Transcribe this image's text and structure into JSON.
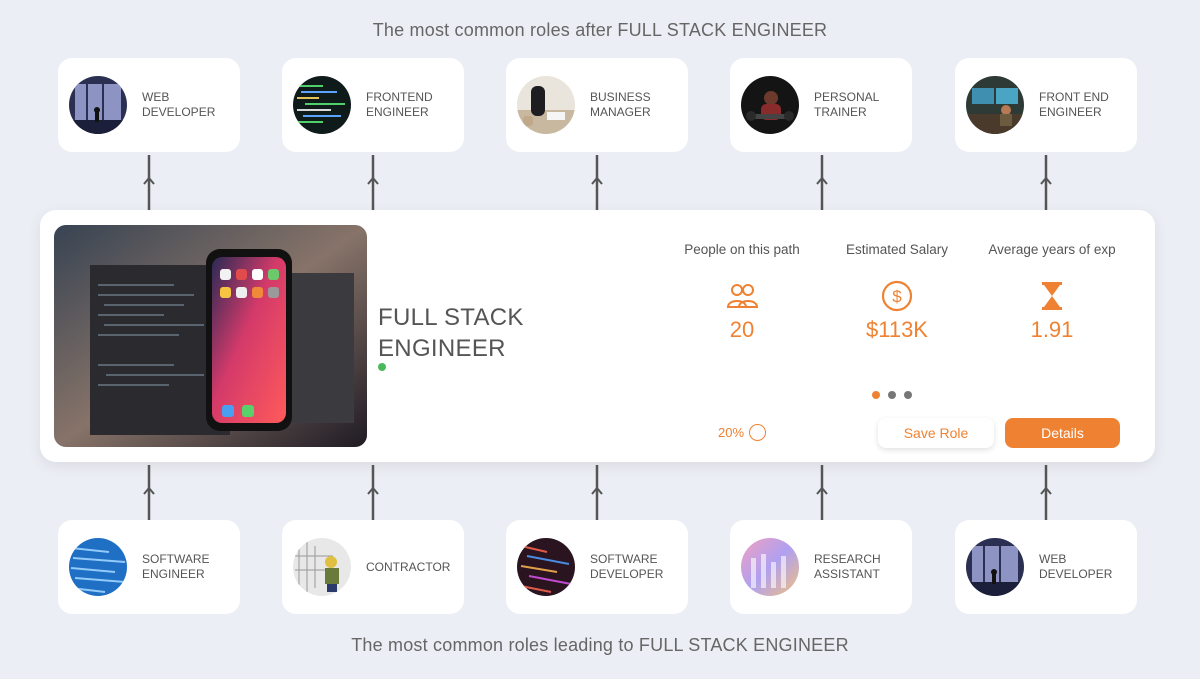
{
  "headings": {
    "after": "The most common roles after FULL STACK ENGINEER",
    "before": "The most common roles leading to FULL STACK ENGINEER"
  },
  "next_roles": [
    {
      "line1": "WEB",
      "line2": "DEVELOPER"
    },
    {
      "line1": "FRONTEND",
      "line2": "ENGINEER"
    },
    {
      "line1": "BUSINESS",
      "line2": "MANAGER"
    },
    {
      "line1": "PERSONAL",
      "line2": "TRAINER"
    },
    {
      "line1": "FRONT END",
      "line2": "ENGINEER"
    }
  ],
  "prev_roles": [
    {
      "line1": "SOFTWARE",
      "line2": "ENGINEER"
    },
    {
      "line1": "CONTRACTOR",
      "line2": ""
    },
    {
      "line1": "SOFTWARE",
      "line2": "DEVELOPER"
    },
    {
      "line1": "RESEARCH",
      "line2": "ASSISTANT"
    },
    {
      "line1": "WEB",
      "line2": "DEVELOPER"
    }
  ],
  "current_role": {
    "title_line1": "FULL STACK",
    "title_line2": "ENGINEER",
    "stats": [
      {
        "label": "People on this path",
        "value": "20",
        "icon": "people-icon"
      },
      {
        "label": "Estimated Salary",
        "value": "$113K",
        "icon": "dollar-icon"
      },
      {
        "label": "Average years of exp",
        "value": "1.91",
        "icon": "hourglass-icon"
      }
    ],
    "progress_text": "20%",
    "save_label": "Save Role",
    "details_label": "Details",
    "carousel_active_index": 0
  },
  "colors": {
    "accent": "#ef8232",
    "status": "#4cb85c",
    "background": "#eceef5"
  }
}
